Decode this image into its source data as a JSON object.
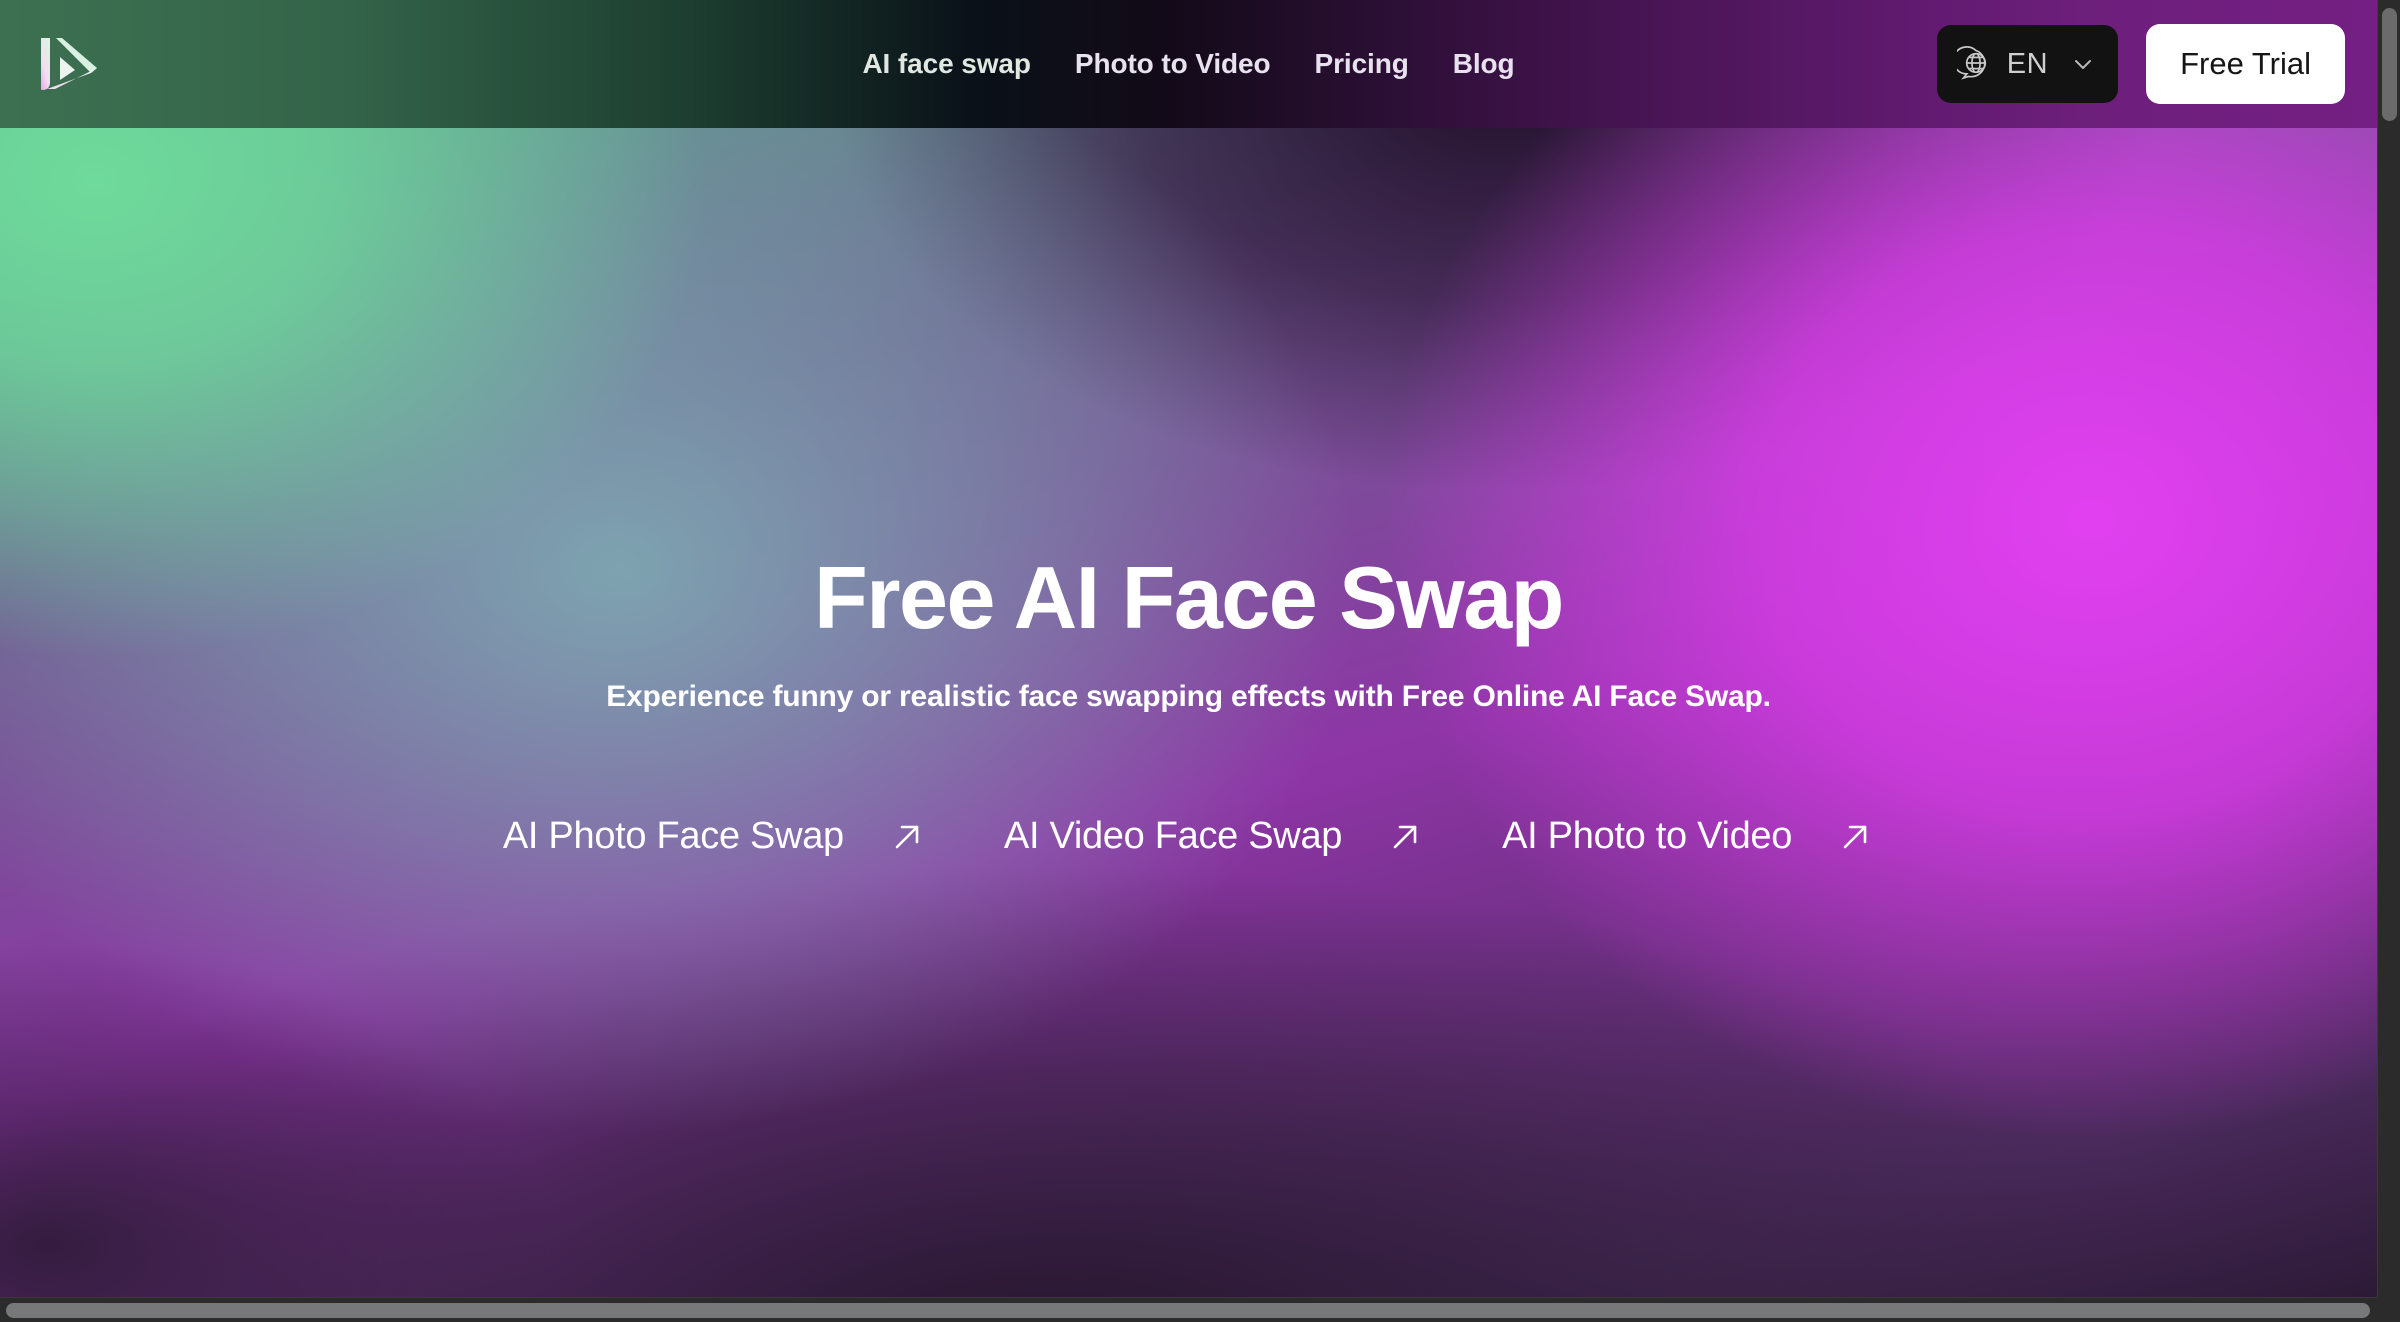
{
  "header": {
    "logo_name": "brand-logo",
    "nav_items": [
      {
        "label": "AI face swap"
      },
      {
        "label": "Photo to Video"
      },
      {
        "label": "Pricing"
      },
      {
        "label": "Blog"
      }
    ],
    "language": {
      "code": "EN",
      "icon": "globe-icon",
      "chevron": "chevron-down-icon"
    },
    "cta": {
      "label": "Free Trial"
    }
  },
  "hero": {
    "title": "Free AI Face Swap",
    "subtitle": "Experience funny or realistic face swapping effects with Free Online AI Face Swap.",
    "links": [
      {
        "label": "AI Photo Face Swap",
        "icon": "arrow-up-right-icon"
      },
      {
        "label": "AI Video Face Swap",
        "icon": "arrow-up-right-icon"
      },
      {
        "label": "AI Photo to Video",
        "icon": "arrow-up-right-icon"
      }
    ]
  },
  "colors": {
    "accent_green": "#6eda9b",
    "accent_magenta": "#e140f0",
    "deep_purple": "#5a2f6e",
    "header_green": "#3d7051",
    "header_purple": "#741f83",
    "cta_background": "#ffffff",
    "cta_text": "#151515",
    "lang_background": "#121212",
    "text_white": "#ffffff"
  },
  "scrollbars": {
    "vertical_present": true,
    "horizontal_present": true
  }
}
